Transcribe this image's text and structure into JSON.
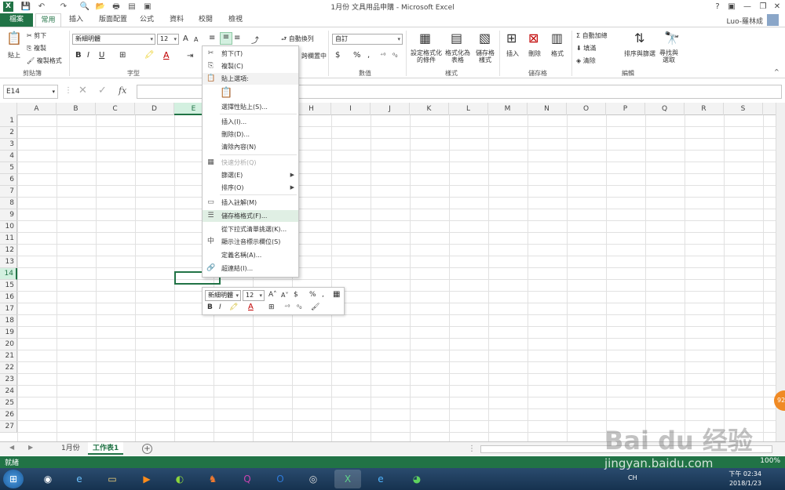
{
  "window": {
    "title": "1月份 文具用品申購 - Microsoft Excel",
    "app_icon": "X",
    "user": "Luo-羅林成",
    "help": "?",
    "minimize": "—",
    "restore": "❐",
    "close": "✕"
  },
  "tabs": [
    "檔案",
    "常用",
    "插入",
    "版面配置",
    "公式",
    "資料",
    "校閱",
    "檢視"
  ],
  "ribbon": {
    "clipboard": {
      "paste": "貼上",
      "cut": "剪下",
      "copy": "複製",
      "format_painter": "複製格式",
      "label": "剪貼簿"
    },
    "font": {
      "name": "新細明體",
      "size": "12",
      "grow": "A",
      "shrink": "A",
      "bold": "B",
      "italic": "I",
      "underline": "U",
      "label": "字型"
    },
    "alignment": {
      "wrap": "自動換列",
      "merge": "跨欄置中"
    },
    "number": {
      "format": "自訂",
      "currency": "$",
      "percent": "%",
      "comma": ",",
      "label": "數值"
    },
    "styles": {
      "cond": "設定格式化的條件",
      "table": "格式化為表格",
      "cell": "儲存格樣式",
      "label": "樣式"
    },
    "cells": {
      "insert": "插入",
      "delete": "刪除",
      "format": "格式",
      "label": "儲存格"
    },
    "editing": {
      "autosum": "自動加總",
      "fill": "填滿",
      "clear": "清除",
      "sort": "排序與篩選",
      "find": "尋找與選取",
      "label": "編輯"
    }
  },
  "formula_bar": {
    "namebox": "E14",
    "cancel": "✕",
    "enter": "✓",
    "fx": "fx"
  },
  "columns": [
    "A",
    "B",
    "C",
    "D",
    "E",
    "F",
    "G",
    "H",
    "I",
    "J",
    "K",
    "L",
    "M",
    "N",
    "O",
    "P",
    "Q",
    "R",
    "S"
  ],
  "rows": [
    "1",
    "2",
    "3",
    "4",
    "5",
    "6",
    "7",
    "8",
    "9",
    "10",
    "11",
    "12",
    "13",
    "14",
    "15",
    "16",
    "17",
    "18",
    "19",
    "20",
    "21",
    "22",
    "23",
    "24",
    "25",
    "26",
    "27"
  ],
  "selected_column": "E",
  "selected_row": "14",
  "context_menu": [
    {
      "label": "剪下(T)",
      "icon": "scissors-icon",
      "glyph": "✂"
    },
    {
      "label": "複製(C)",
      "icon": "copy-icon",
      "glyph": "⎘"
    },
    {
      "label": "貼上選項:",
      "icon": "paste-icon",
      "glyph": "📋"
    },
    {
      "label": "選擇性貼上(S)...",
      "icon": "",
      "glyph": ""
    },
    {
      "label": "插入(I)...",
      "icon": "",
      "glyph": ""
    },
    {
      "label": "刪除(D)...",
      "icon": "",
      "glyph": ""
    },
    {
      "label": "清除內容(N)",
      "icon": "",
      "glyph": ""
    },
    {
      "label": "快速分析(Q)",
      "icon": "quick-analysis-icon",
      "glyph": "▦"
    },
    {
      "label": "篩選(E)",
      "icon": "",
      "glyph": ""
    },
    {
      "label": "排序(O)",
      "icon": "",
      "glyph": ""
    },
    {
      "label": "插入註解(M)",
      "icon": "comment-icon",
      "glyph": "▭"
    },
    {
      "label": "儲存格格式(F)...",
      "icon": "format-cells-icon",
      "glyph": "☰"
    },
    {
      "label": "從下拉式清單挑選(K)...",
      "icon": "",
      "glyph": ""
    },
    {
      "label": "顯示注音標示欄位(S)",
      "icon": "phonetic-icon",
      "glyph": "中"
    },
    {
      "label": "定義名稱(A)...",
      "icon": "",
      "glyph": ""
    },
    {
      "label": "超連結(I)...",
      "icon": "hyperlink-icon",
      "glyph": "🔗"
    }
  ],
  "mini_toolbar": {
    "font": "新細明體",
    "size": "12",
    "currency": "$",
    "percent": "%",
    "comma": ",",
    "bold": "B",
    "italic": "I"
  },
  "sheets": [
    "1月份",
    "工作表1"
  ],
  "active_sheet": "工作表1",
  "status": {
    "mode": "就緒",
    "zoom": "100%"
  },
  "taskbar": {
    "lang": "CH",
    "time": "下午 02:34",
    "date": "2018/1/23"
  },
  "watermark": {
    "logo": "Bai du 经验",
    "url": "jingyan.baidu.com",
    "badge": "92"
  }
}
